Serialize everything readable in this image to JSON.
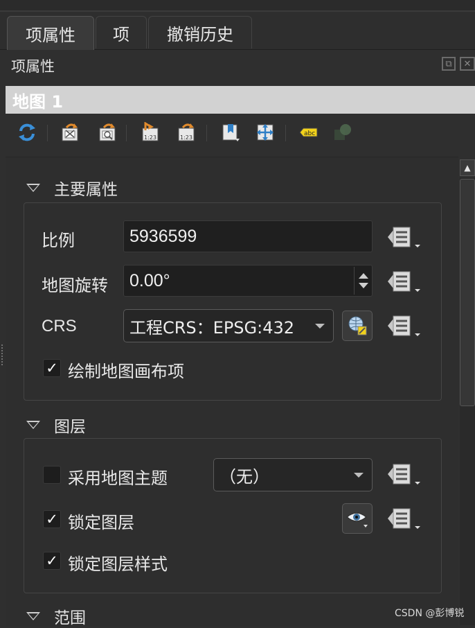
{
  "tabs": [
    {
      "label": "项属性",
      "active": true
    },
    {
      "label": "项",
      "active": false
    },
    {
      "label": "撤销历史",
      "active": false
    }
  ],
  "panel": {
    "title": "项属性",
    "float_icon": "float-icon",
    "close_icon": "close-icon"
  },
  "item_name": "地图 1",
  "toolbar": {
    "icons": [
      "refresh-icon",
      "set-extent-from-canvas-icon",
      "view-extent-in-canvas-icon",
      "set-scale-from-canvas-icon",
      "set-canvas-scale-icon",
      "bookmark-icon",
      "move-content-icon",
      "label-settings-icon",
      "map-clipping-icon"
    ]
  },
  "sections": {
    "main": {
      "title": "主要属性",
      "scale_label": "比例",
      "scale_value": "5936599",
      "rotation_label": "地图旋转",
      "rotation_value": "0.00°",
      "crs_label": "CRS",
      "crs_value": "工程CRS：EPSG:432",
      "draw_items_label": "绘制地图画布项",
      "draw_items_checked": true
    },
    "layers": {
      "title": "图层",
      "follow_theme_label": "采用地图主题",
      "follow_theme_checked": false,
      "theme_value": "（无）",
      "lock_layers_label": "锁定图层",
      "lock_layers_checked": true,
      "lock_styles_label": "锁定图层样式",
      "lock_styles_checked": true
    },
    "extent": {
      "title": "范围"
    }
  },
  "check_mark": "✓",
  "watermark": "CSDN @彭博锐",
  "colors": {
    "background": "#2f2f2f",
    "field": "#1f1f1f",
    "item_bar": "#d2d2d2",
    "icon_orange": "#e08a2c",
    "icon_blue": "#2f7fc6"
  }
}
